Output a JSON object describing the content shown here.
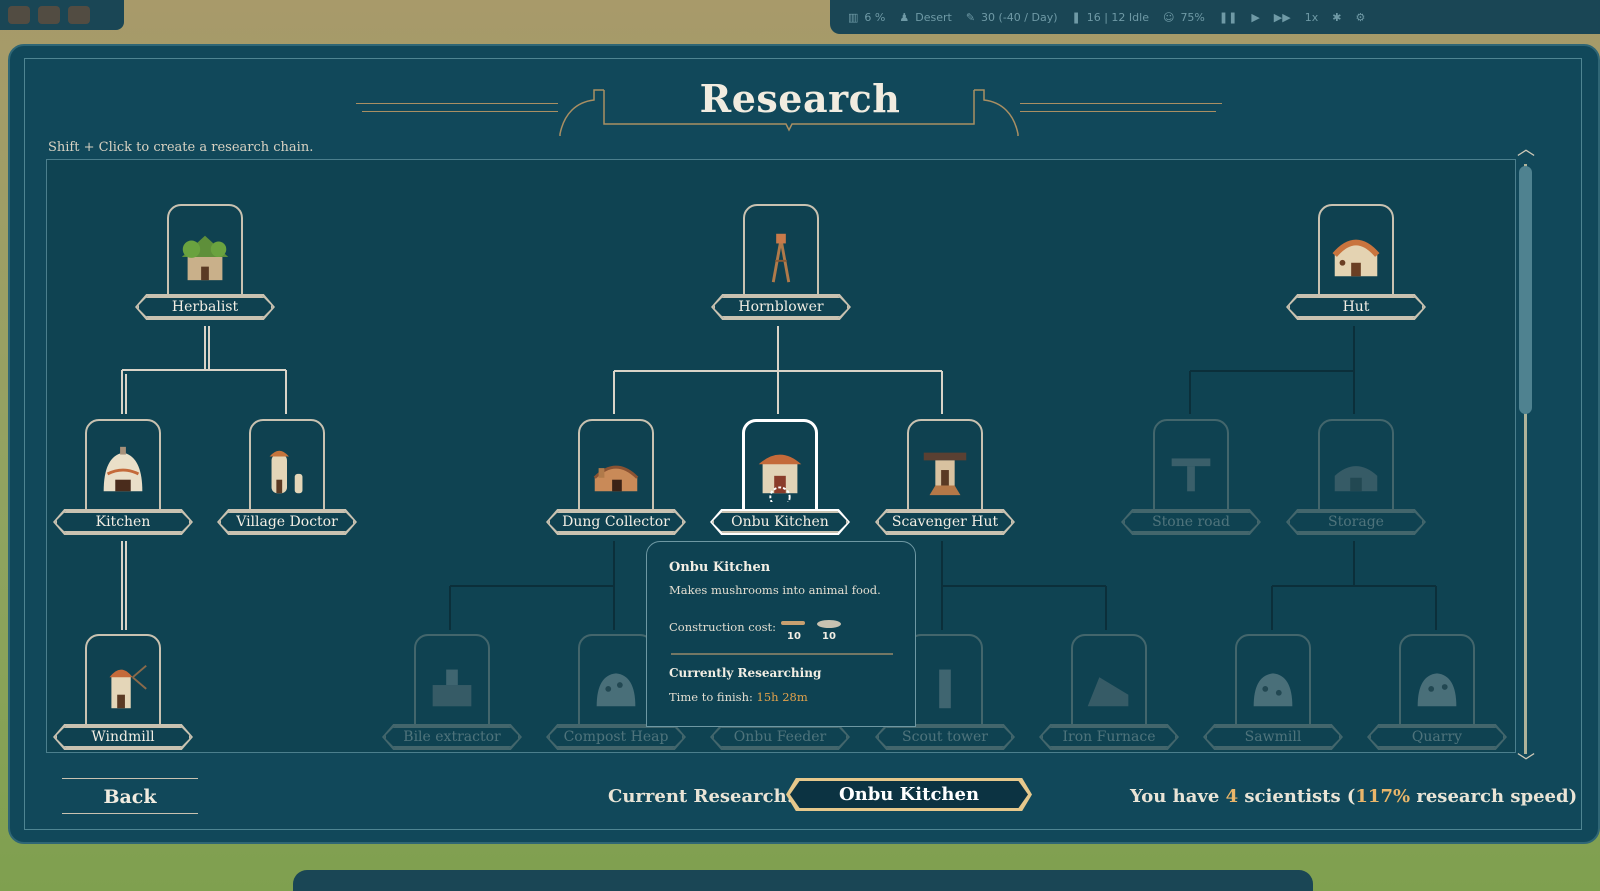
{
  "hud": {
    "temperature": "6 %",
    "biome": "Desert",
    "food": "30 (-40 / Day)",
    "population": "16 | 12 Idle",
    "happiness": "75%",
    "speed": "1x"
  },
  "title": "Research",
  "hint": "Shift + Click to create a research chain.",
  "nodes": {
    "herbalist": "Herbalist",
    "hornblower": "Hornblower",
    "hut": "Hut",
    "kitchen": "Kitchen",
    "village_doctor": "Village Doctor",
    "dung_collector": "Dung Collector",
    "onbu_kitchen": "Onbu Kitchen",
    "scavenger_hut": "Scavenger Hut",
    "stone_road": "Stone road",
    "storage": "Storage",
    "windmill": "Windmill",
    "bile_extractor": "Bile extractor",
    "compost_heap": "Compost Heap",
    "onbu_feeder": "Onbu Feeder",
    "scout_tower": "Scout tower",
    "iron_furnace": "Iron Furnace",
    "sawmill": "Sawmill",
    "quarry": "Quarry"
  },
  "tooltip": {
    "title": "Onbu Kitchen",
    "description": "Makes mushrooms into animal food.",
    "cost_label": "Construction cost:",
    "costs": [
      "10",
      "10"
    ],
    "status": "Currently Researching",
    "time_label": "Time to finish:",
    "time_value": "15h 28m"
  },
  "footer": {
    "back": "Back",
    "current_research_label": "Current Research:",
    "current_research_value": "Onbu Kitchen",
    "scientists_prefix": "You have",
    "scientists_count": "4",
    "scientists_word": "scientists (",
    "speed": "117%",
    "speed_suffix": "research speed)"
  },
  "colors": {
    "panel": "#11485a",
    "accent": "#e9b66a",
    "border": "#c9c2b1"
  }
}
